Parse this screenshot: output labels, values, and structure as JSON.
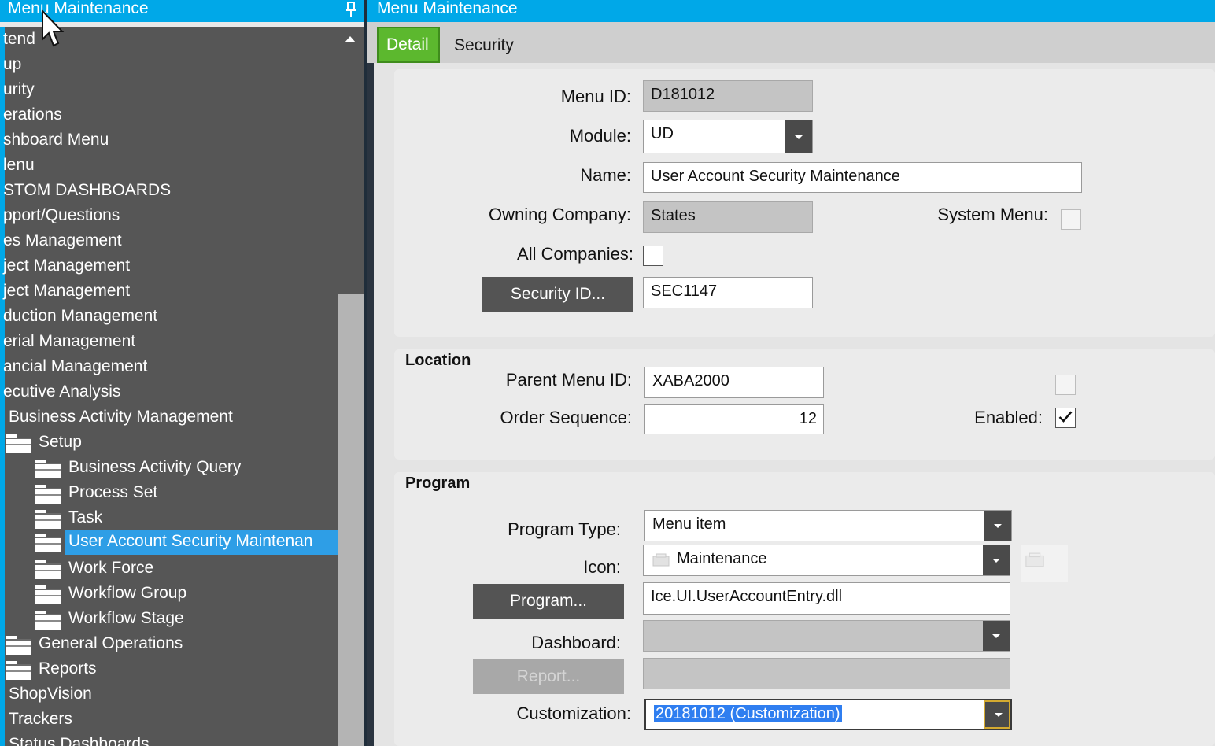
{
  "left_panel": {
    "title": "Menu Maintenance",
    "tree": [
      {
        "label": "tend"
      },
      {
        "label": "up"
      },
      {
        "label": "urity"
      },
      {
        "label": "erations"
      },
      {
        "label": "shboard Menu"
      },
      {
        "label": "lenu"
      },
      {
        "label": "STOM DASHBOARDS"
      },
      {
        "label": "pport/Questions"
      },
      {
        "label": "es Management"
      },
      {
        "label": "ject Management"
      },
      {
        "label": "ject Management"
      },
      {
        "label": "duction Management"
      },
      {
        "label": "erial Management"
      },
      {
        "label": "ancial Management"
      },
      {
        "label": "ecutive Analysis"
      },
      {
        "label": "Business Activity Management"
      },
      {
        "label": "Setup"
      },
      {
        "label": "Business Activity Query"
      },
      {
        "label": "Process Set"
      },
      {
        "label": "Task"
      },
      {
        "label": "User Account Security Maintenan"
      },
      {
        "label": "Work Force"
      },
      {
        "label": "Workflow Group"
      },
      {
        "label": "Workflow Stage"
      },
      {
        "label": "General Operations"
      },
      {
        "label": "Reports"
      },
      {
        "label": "ShopVision"
      },
      {
        "label": "Trackers"
      },
      {
        "label": "Status Dashboards"
      }
    ]
  },
  "right_panel": {
    "title": "Menu Maintenance",
    "tabs": [
      {
        "label": "Detail",
        "active": true
      },
      {
        "label": "Security",
        "active": false
      }
    ],
    "detail": {
      "menu_id_label": "Menu ID:",
      "menu_id_value": "D181012",
      "module_label": "Module:",
      "module_value": "UD",
      "name_label": "Name:",
      "name_value": "User Account Security Maintenance",
      "owning_company_label": "Owning Company:",
      "owning_company_value": "States",
      "system_menu_label": "System Menu:",
      "system_menu_checked": false,
      "all_companies_label": "All Companies:",
      "all_companies_checked": false,
      "security_id_button": "Security ID...",
      "security_id_value": "SEC1147"
    },
    "location": {
      "title": "Location",
      "parent_menu_id_label": "Parent Menu ID:",
      "parent_menu_id_value": "XABA2000",
      "order_sequence_label": "Order Sequence:",
      "order_sequence_value": "12",
      "enabled_label": "Enabled:",
      "enabled_checked": true
    },
    "program": {
      "title": "Program",
      "program_type_label": "Program Type:",
      "program_type_value": "Menu item",
      "icon_label": "Icon:",
      "icon_value": "Maintenance",
      "program_button": "Program...",
      "program_value": "Ice.UI.UserAccountEntry.dll",
      "dashboard_label": "Dashboard:",
      "dashboard_value": "",
      "report_button": "Report...",
      "report_value": "",
      "customization_label": "Customization:",
      "customization_value": "20181012 (Customization)"
    }
  },
  "colors": {
    "titlebar": "#00a8e8",
    "tree_bg": "#565656",
    "selected": "#2e9ee6",
    "active_tab": "#5cb82e",
    "button": "#545454"
  }
}
